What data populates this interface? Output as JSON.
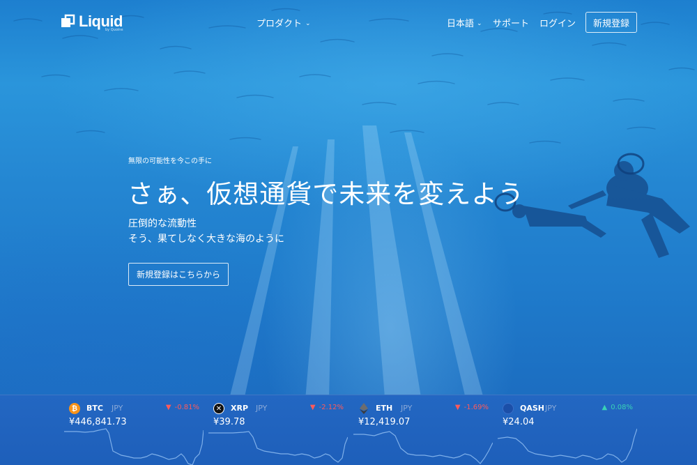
{
  "header": {
    "logo_text": "Liquid",
    "logo_sub": "by Quoine",
    "nav": {
      "product": "プロダクト",
      "language": "日本語",
      "support": "サポート",
      "login": "ログイン",
      "signup": "新規登録"
    }
  },
  "hero": {
    "tagline": "無限の可能性を今この手に",
    "headline": "さぁ、仮想通貨で未来を変えよう",
    "sub1": "圧倒的な流動性",
    "sub2": "そう、果てしなく大きな海のように",
    "cta": "新規登録はこちらから"
  },
  "ticker": [
    {
      "symbol": "BTC",
      "quote": "JPY",
      "change": "-0.81%",
      "direction": "down",
      "price": "¥446,841.73",
      "icon": "bitcoin-icon",
      "color": "#f7931a"
    },
    {
      "symbol": "XRP",
      "quote": "JPY",
      "change": "-2.12%",
      "direction": "down",
      "price": "¥39.78",
      "icon": "xrp-icon",
      "color": "#111111"
    },
    {
      "symbol": "ETH",
      "quote": "JPY",
      "change": "-1.69%",
      "direction": "down",
      "price": "¥12,419.07",
      "icon": "ethereum-icon",
      "color": "#3c3c3d"
    },
    {
      "symbol": "QASH",
      "quote": "JPY",
      "change": "0.08%",
      "direction": "up",
      "price": "¥24.04",
      "icon": "qash-icon",
      "color": "#1b4fa8"
    }
  ],
  "colors": {
    "accent_down": "#ff5a5a",
    "accent_up": "#38d2b6",
    "ticker_bg": "#2367c2"
  }
}
